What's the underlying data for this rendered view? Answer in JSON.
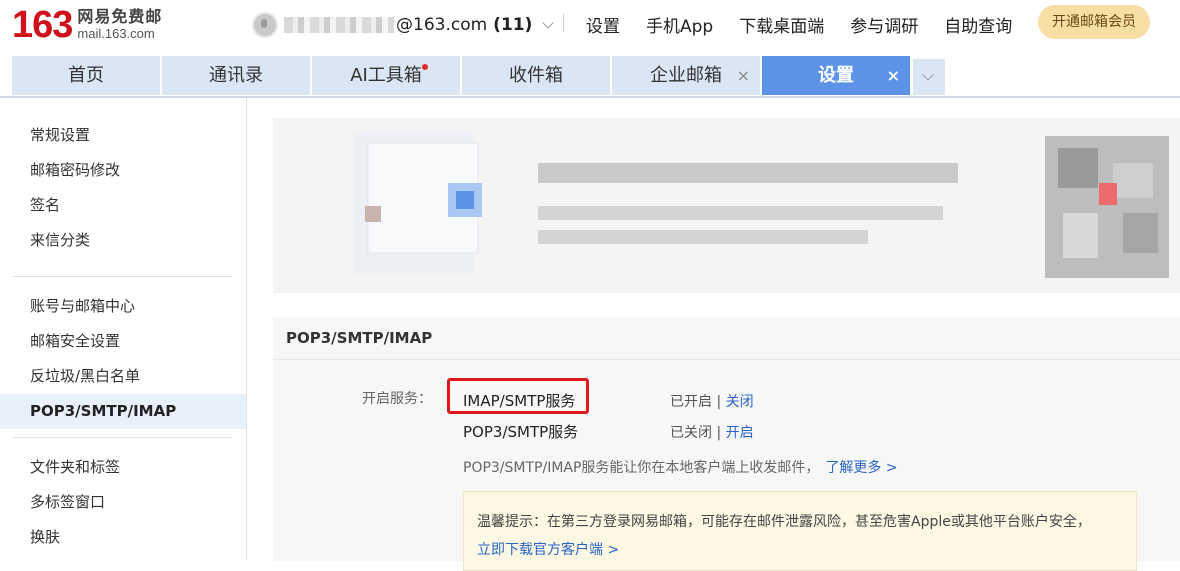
{
  "header": {
    "logo_number": "163",
    "logo_title": "网易免费邮",
    "logo_domain": "mail.163.com",
    "account_suffix": "@163.com",
    "unread_count": "(11)",
    "links": [
      "设置",
      "手机App",
      "下载桌面端",
      "参与调研",
      "自助查询"
    ],
    "vip_button": "开通邮箱会员",
    "vip_color": "#f7dea4"
  },
  "tabs": [
    {
      "label": "首页"
    },
    {
      "label": "通讯录"
    },
    {
      "label": "AI工具箱"
    },
    {
      "label": "收件箱"
    },
    {
      "label": "企业邮箱",
      "close": "×"
    },
    {
      "label": "设置",
      "close": "×"
    }
  ],
  "sidebar": {
    "groups": [
      [
        "常规设置",
        "邮箱密码修改",
        "签名",
        "来信分类"
      ],
      [
        "账号与邮箱中心",
        "邮箱安全设置",
        "反垃圾/黑白名单",
        "POP3/SMTP/IMAP"
      ],
      [
        "文件夹和标签",
        "多标签窗口",
        "换肤"
      ]
    ],
    "active": "POP3/SMTP/IMAP"
  },
  "panel": {
    "title": "POP3/SMTP/IMAP",
    "service_label": "开启服务：",
    "services": [
      {
        "name": "IMAP/SMTP服务",
        "status": "已开启",
        "sep": "|",
        "action": "关闭"
      },
      {
        "name": "POP3/SMTP服务",
        "status": "已关闭",
        "sep": "|",
        "action": "开启"
      }
    ],
    "description": "POP3/SMTP/IMAP服务能让你在本地客户端上收发邮件，",
    "learn_more": "了解更多 >",
    "tip_text": "温馨提示：在第三方登录网易邮箱，可能存在邮件泄露风险，甚至危害Apple或其他平台账户安全，",
    "tip_link": "立即下载官方客户端 >"
  },
  "colors": {
    "brand_red": "#d0111b",
    "tab_active": "#5d93e6",
    "link": "#2a64c5",
    "highlight": "#e3161b"
  }
}
